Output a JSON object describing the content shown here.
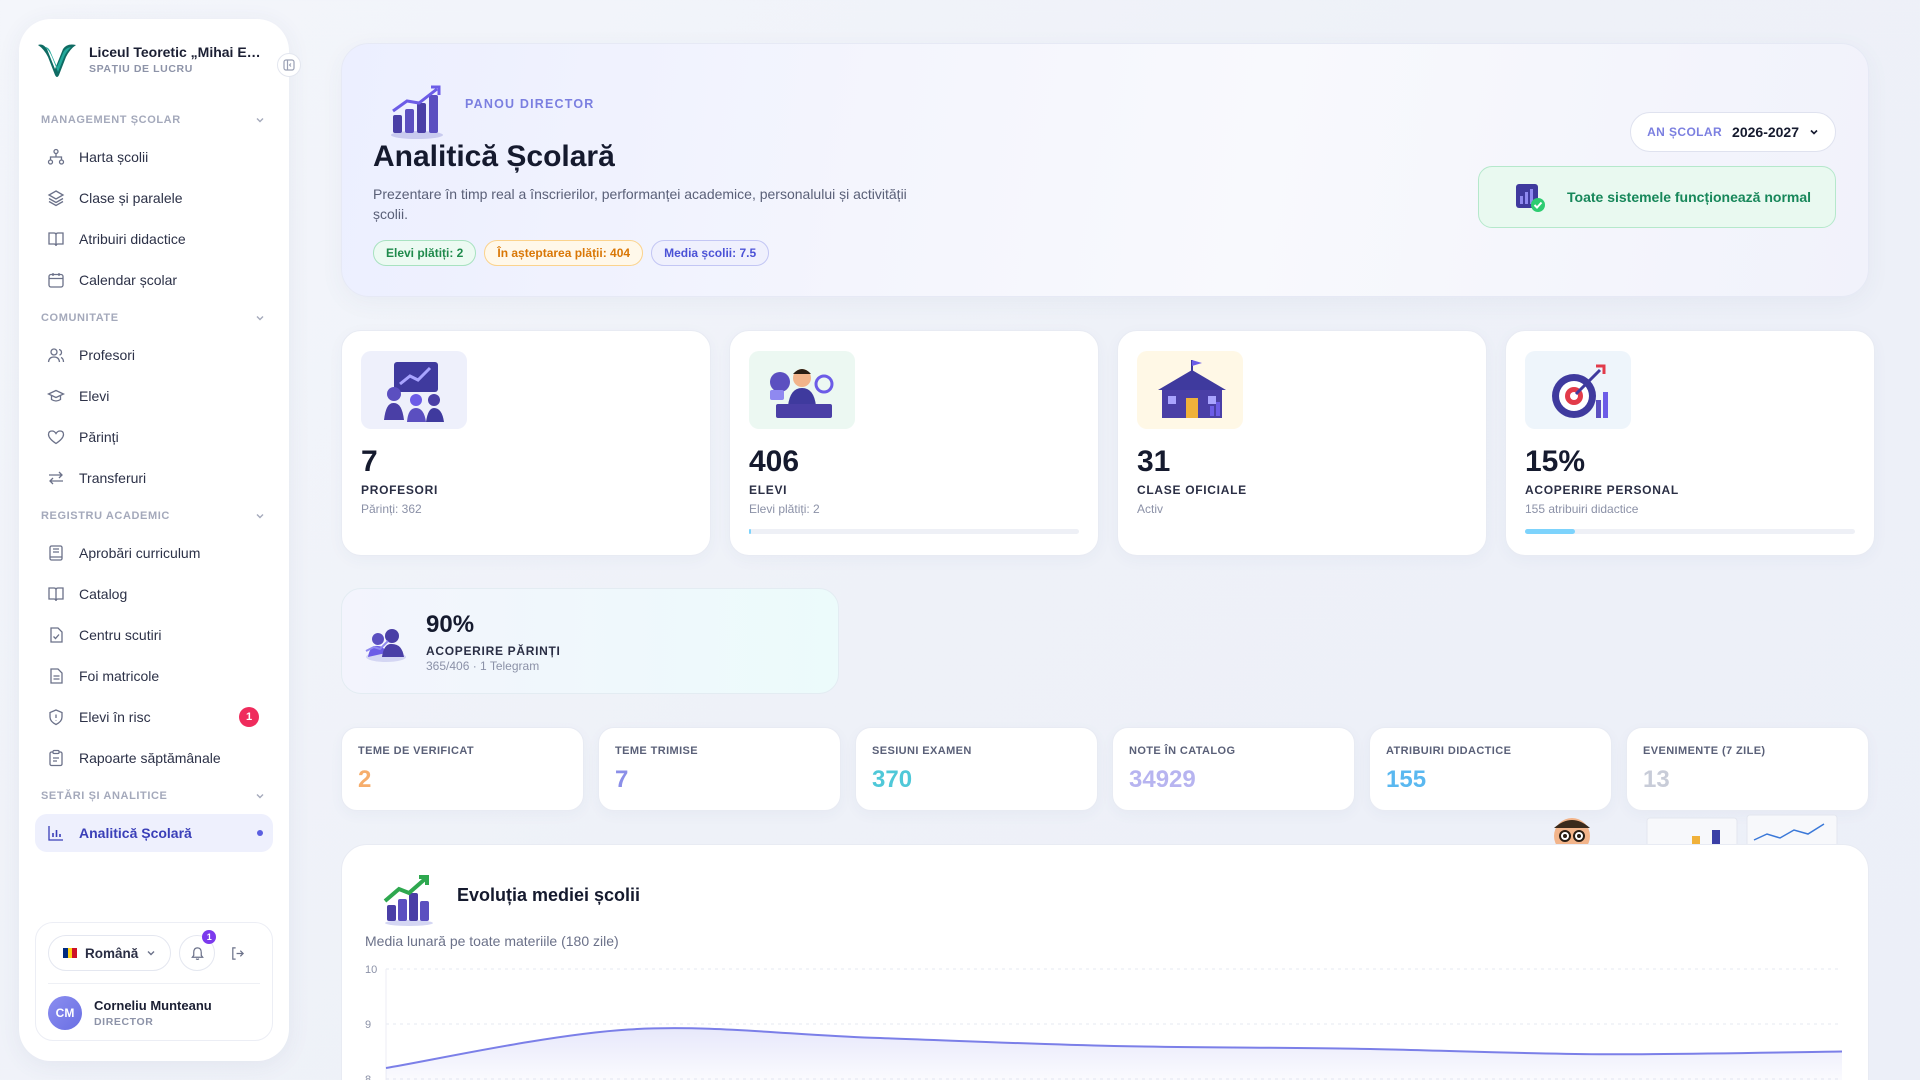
{
  "sidebar": {
    "school_name": "Liceul Teoretic „Mihai Emi...",
    "workspace": "SPAȚIU DE LUCRU",
    "sections": [
      {
        "title": "MANAGEMENT ȘCOLAR",
        "items": [
          {
            "label": "Harta școlii",
            "icon": "hierarchy-icon"
          },
          {
            "label": "Clase și paralele",
            "icon": "layers-icon"
          },
          {
            "label": "Atribuiri didactice",
            "icon": "book-open-icon"
          },
          {
            "label": "Calendar școlar",
            "icon": "calendar-icon"
          }
        ]
      },
      {
        "title": "COMUNITATE",
        "items": [
          {
            "label": "Profesori",
            "icon": "users-icon"
          },
          {
            "label": "Elevi",
            "icon": "graduation-cap-icon"
          },
          {
            "label": "Părinți",
            "icon": "heart-icon"
          },
          {
            "label": "Transferuri",
            "icon": "transfer-arrows-icon"
          }
        ]
      },
      {
        "title": "REGISTRU ACADEMIC",
        "items": [
          {
            "label": "Aprobări curriculum",
            "icon": "book-icon"
          },
          {
            "label": "Catalog",
            "icon": "book-open-icon"
          },
          {
            "label": "Centru scutiri",
            "icon": "document-check-icon"
          },
          {
            "label": "Foi matricole",
            "icon": "document-icon"
          },
          {
            "label": "Elevi în risc",
            "icon": "shield-icon",
            "badge": "1"
          },
          {
            "label": "Rapoarte săptămânale",
            "icon": "clipboard-icon"
          }
        ]
      },
      {
        "title": "SETĂRI ȘI ANALITICE",
        "items": [
          {
            "label": "Analitică Școlară",
            "icon": "bar-chart-icon",
            "active": true
          }
        ]
      }
    ],
    "language": "Română",
    "notifications_count": "1",
    "user": {
      "initials": "CM",
      "name": "Corneliu Munteanu",
      "role": "DIRECTOR"
    }
  },
  "hero": {
    "kicker": "PANOU DIRECTOR",
    "title": "Analitică Școlară",
    "description": "Prezentare în timp real a înscrierilor, performanței academice, personalului și activității școlii.",
    "chips": {
      "paid": "Elevi plătiți: 2",
      "pending": "În așteptarea plății: 404",
      "average": "Media școlii: 7.5"
    },
    "year_label": "AN ȘCOLAR",
    "year_value": "2026-2027",
    "status": "Toate sistemele funcționează normal"
  },
  "stats": [
    {
      "value": "7",
      "label": "PROFESORI",
      "sub": "Părinți: 362",
      "icon": "teacher-presentation-icon",
      "bg": "#eef0fb"
    },
    {
      "value": "406",
      "label": "ELEVI",
      "sub": "Elevi plătiți: 2",
      "icon": "student-desk-icon",
      "bg": "#ecf8f2",
      "progress": 0.005
    },
    {
      "value": "31",
      "label": "CLASE OFICIALE",
      "sub": "Activ",
      "icon": "school-building-icon",
      "bg": "#fff8e6"
    },
    {
      "value": "15%",
      "label": "ACOPERIRE PERSONAL",
      "sub": "155 atribuiri didactice",
      "icon": "target-icon",
      "bg": "#eef5fb",
      "progress": 0.15
    }
  ],
  "parents": {
    "value": "90%",
    "label": "ACOPERIRE PĂRINȚI",
    "sub": "365/406 · 1 Telegram"
  },
  "mini_stats": [
    {
      "label": "TEME DE VERIFICAT",
      "value": "2",
      "color": "#f6ad6b"
    },
    {
      "label": "TEME TRIMISE",
      "value": "7",
      "color": "#8b8fe8"
    },
    {
      "label": "SESIUNI EXAMEN",
      "value": "370",
      "color": "#4fc8d8"
    },
    {
      "label": "NOTE ÎN CATALOG",
      "value": "34929",
      "color": "#b7b4f0"
    },
    {
      "label": "ATRIBUIRI DIDACTICE",
      "value": "155",
      "color": "#5ab8f0"
    },
    {
      "label": "EVENIMENTE (7 ZILE)",
      "value": "13",
      "color": "#c8ccd8"
    }
  ],
  "chart": {
    "title": "Evoluția mediei școlii",
    "subtitle": "Media lunară pe toate materiile (180 zile)",
    "colors": {
      "line": "#7b7fe8"
    }
  },
  "chart_data": {
    "type": "area",
    "title": "Evoluția mediei școlii",
    "subtitle": "Media lunară pe toate materiile (180 zile)",
    "y_ticks": [
      "10",
      "9",
      "8"
    ],
    "ylim": [
      8,
      10
    ],
    "x": [
      0,
      1,
      2,
      3,
      4,
      5,
      6
    ],
    "series": [
      {
        "values": [
          8.2,
          8.9,
          8.75,
          8.6,
          8.55,
          8.45,
          8.5
        ]
      }
    ],
    "grid": true
  }
}
